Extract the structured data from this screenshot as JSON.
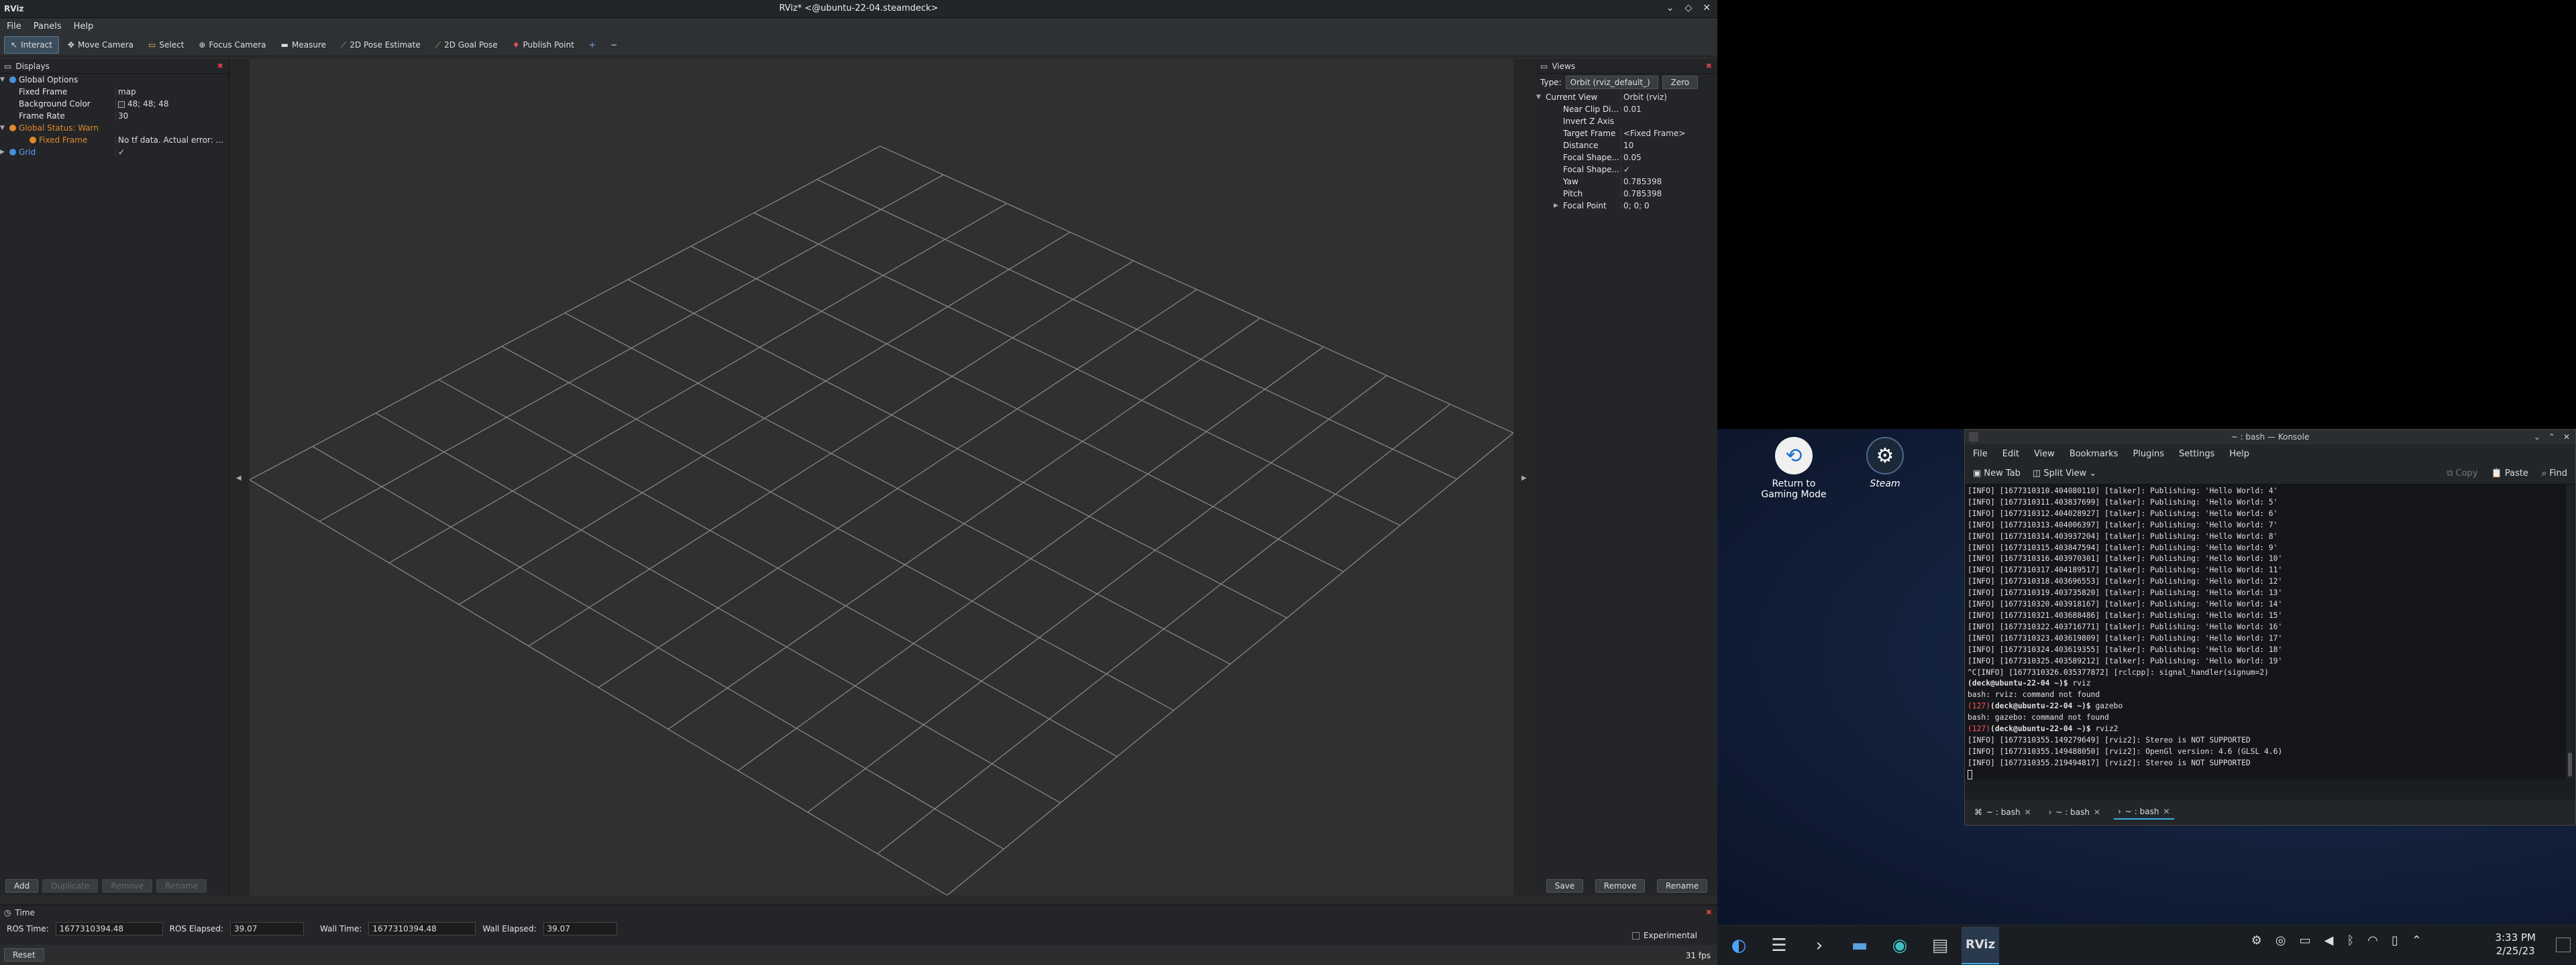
{
  "rviz": {
    "app_icon": "RViz",
    "title": "RViz* <@ubuntu-22-04.steamdeck>",
    "menus": [
      "File",
      "Panels",
      "Help"
    ],
    "tools": [
      {
        "label": "Interact",
        "icon": "cursor-icon",
        "glyph": "↖"
      },
      {
        "label": "Move Camera",
        "icon": "move-icon",
        "glyph": "✥"
      },
      {
        "label": "Select",
        "icon": "select-icon",
        "glyph": "▭"
      },
      {
        "label": "Focus Camera",
        "icon": "focus-icon",
        "glyph": "⊕"
      },
      {
        "label": "Measure",
        "icon": "ruler-icon",
        "glyph": "▬"
      },
      {
        "label": "2D Pose Estimate",
        "icon": "green-arrow-icon",
        "glyph": "⟋"
      },
      {
        "label": "2D Goal Pose",
        "icon": "green-arrow-icon",
        "glyph": "⟋"
      },
      {
        "label": "Publish Point",
        "icon": "pin-icon",
        "glyph": "♦"
      }
    ],
    "tool_plus": "+",
    "tool_minus": "−",
    "displays": {
      "title": "Displays",
      "rows": [
        {
          "name": "Global Options",
          "value": ""
        },
        {
          "name": "Fixed Frame",
          "value": "map"
        },
        {
          "name": "Background Color",
          "value": "48; 48; 48"
        },
        {
          "name": "Frame Rate",
          "value": "30"
        },
        {
          "name": "Global Status: Warn",
          "value": ""
        },
        {
          "name": "Fixed Frame",
          "value": "No tf data.  Actual error: ..."
        },
        {
          "name": "Grid",
          "value": "✓"
        }
      ],
      "buttons": [
        "Add",
        "Duplicate",
        "Remove",
        "Rename"
      ]
    },
    "views": {
      "title": "Views",
      "type_label": "Type:",
      "type_value": "Orbit (rviz_default_)",
      "zero": "Zero",
      "rows": [
        {
          "name": "Current View",
          "value": "Orbit (rviz)"
        },
        {
          "name": "Near Clip Di...",
          "value": "0.01"
        },
        {
          "name": "Invert Z Axis",
          "value": ""
        },
        {
          "name": "Target Frame",
          "value": "<Fixed Frame>"
        },
        {
          "name": "Distance",
          "value": "10"
        },
        {
          "name": "Focal Shape...",
          "value": "0.05"
        },
        {
          "name": "Focal Shape...",
          "value": "✓"
        },
        {
          "name": "Yaw",
          "value": "0.785398"
        },
        {
          "name": "Pitch",
          "value": "0.785398"
        },
        {
          "name": "Focal Point",
          "value": "0; 0; 0"
        }
      ],
      "buttons": [
        "Save",
        "Remove",
        "Rename"
      ]
    },
    "time": {
      "title": "Time",
      "ros_time_label": "ROS Time:",
      "ros_time": "1677310394.48",
      "ros_elapsed_label": "ROS Elapsed:",
      "ros_elapsed": "39.07",
      "wall_time_label": "Wall Time:",
      "wall_time": "1677310394.48",
      "wall_elapsed_label": "Wall Elapsed:",
      "wall_elapsed": "39.07",
      "experimental": "Experimental"
    },
    "status": {
      "reset": "Reset",
      "fps": "31 fps"
    }
  },
  "desktop": {
    "icons": [
      {
        "label": "Return to Gaming Mode"
      },
      {
        "label": "Steam"
      }
    ]
  },
  "konsole": {
    "title": "~ : bash — Konsole",
    "menus": [
      "File",
      "Edit",
      "View",
      "Bookmarks",
      "Plugins",
      "Settings",
      "Help"
    ],
    "new_tab": "New Tab",
    "split_view": "Split View",
    "copy": "Copy",
    "paste": "Paste",
    "find": "Find",
    "lines": [
      "[INFO] [1677310310.404080110] [talker]: Publishing: 'Hello World: 4'",
      "[INFO] [1677310311.403837699] [talker]: Publishing: 'Hello World: 5'",
      "[INFO] [1677310312.404028927] [talker]: Publishing: 'Hello World: 6'",
      "[INFO] [1677310313.404006397] [talker]: Publishing: 'Hello World: 7'",
      "[INFO] [1677310314.403937204] [talker]: Publishing: 'Hello World: 8'",
      "[INFO] [1677310315.403847594] [talker]: Publishing: 'Hello World: 9'",
      "[INFO] [1677310316.403970301] [talker]: Publishing: 'Hello World: 10'",
      "[INFO] [1677310317.404189517] [talker]: Publishing: 'Hello World: 11'",
      "[INFO] [1677310318.403696553] [talker]: Publishing: 'Hello World: 12'",
      "[INFO] [1677310319.403735820] [talker]: Publishing: 'Hello World: 13'",
      "[INFO] [1677310320.403918167] [talker]: Publishing: 'Hello World: 14'",
      "[INFO] [1677310321.403688486] [talker]: Publishing: 'Hello World: 15'",
      "[INFO] [1677310322.403716771] [talker]: Publishing: 'Hello World: 16'",
      "[INFO] [1677310323.403619809] [talker]: Publishing: 'Hello World: 17'",
      "[INFO] [1677310324.403619355] [talker]: Publishing: 'Hello World: 18'",
      "[INFO] [1677310325.403589212] [talker]: Publishing: 'Hello World: 19'",
      "^C[INFO] [1677310326.035377872] [rclcpp]: signal_handler(signum=2)"
    ],
    "session": [
      {
        "code": "",
        "prompt": "(deck@ubuntu-22-04 ~)$",
        "cmd": " rviz"
      },
      {
        "out": "bash: rviz: command not found"
      },
      {
        "code": "(127)",
        "prompt": "(deck@ubuntu-22-04 ~)$",
        "cmd": " gazebo"
      },
      {
        "out": "bash: gazebo: command not found"
      },
      {
        "code": "(127)",
        "prompt": "(deck@ubuntu-22-04 ~)$",
        "cmd": " rviz2"
      },
      {
        "out": "[INFO] [1677310355.149279649] [rviz2]: Stereo is NOT SUPPORTED"
      },
      {
        "out": "[INFO] [1677310355.149488050] [rviz2]: OpenGl version: 4.6 (GLSL 4.6)"
      },
      {
        "out": "[INFO] [1677310355.219494817] [rviz2]: Stereo is NOT SUPPORTED"
      }
    ],
    "tabs": [
      "~ : bash",
      "~ : bash",
      "~ : bash"
    ]
  },
  "taskbar": {
    "clock_time": "3:33 PM",
    "clock_date": "2/25/23"
  }
}
